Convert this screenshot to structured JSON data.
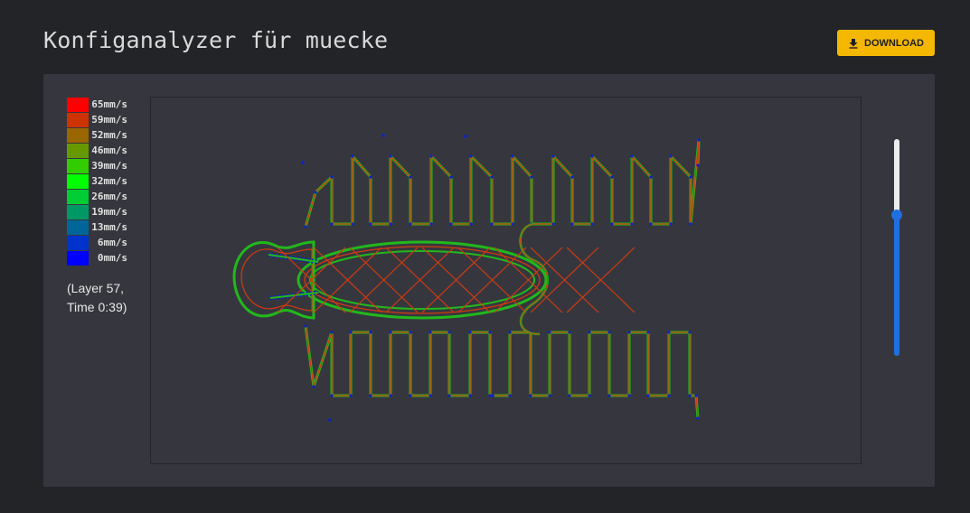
{
  "header": {
    "title": "Konfiganalyzer für muecke",
    "download_label": "DOWNLOAD"
  },
  "colors": {
    "accent": "#f5b800",
    "slider": "#1f6fe0",
    "path_fast": "#d23a10",
    "path_mid": "#22b81c",
    "path_slow": "#0a22c8"
  },
  "legend": [
    {
      "label": "65mm/s",
      "color": "#ff0000"
    },
    {
      "label": "59mm/s",
      "color": "#cc3300"
    },
    {
      "label": "52mm/s",
      "color": "#996600"
    },
    {
      "label": "46mm/s",
      "color": "#669900"
    },
    {
      "label": "39mm/s",
      "color": "#33cc00"
    },
    {
      "label": "32mm/s",
      "color": "#00ff00"
    },
    {
      "label": "26mm/s",
      "color": "#00cc33"
    },
    {
      "label": "19mm/s",
      "color": "#009966"
    },
    {
      "label": "13mm/s",
      "color": "#006699"
    },
    {
      "label": "6mm/s",
      "color": "#0033cc"
    },
    {
      "label": "0mm/s",
      "color": "#0000ff"
    }
  ],
  "layer_info": "(Layer 57, Time 0:39)",
  "layer_slider": {
    "value_fraction": 0.65
  }
}
